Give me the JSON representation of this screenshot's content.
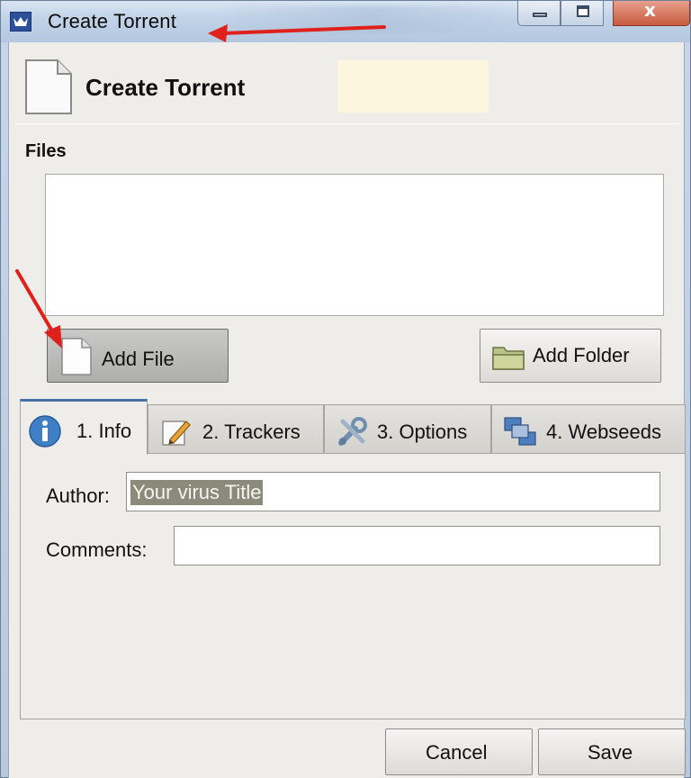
{
  "window": {
    "title": "Create Torrent",
    "controls": [
      "minimize",
      "maximize",
      "close"
    ],
    "close_glyph": "x"
  },
  "header": {
    "title": "Create Torrent",
    "icon": "document-icon"
  },
  "files": {
    "label": "Files",
    "add_file_label": "Add File",
    "add_folder_label": "Add Folder"
  },
  "tabs": [
    {
      "label": "1. Info",
      "icon": "info-icon",
      "selected": true
    },
    {
      "label": "2. Trackers",
      "icon": "pencil-icon",
      "selected": false
    },
    {
      "label": "3. Options",
      "icon": "tools-icon",
      "selected": false
    },
    {
      "label": "4. Webseeds",
      "icon": "network-icon",
      "selected": false
    }
  ],
  "info": {
    "author_label": "Author:",
    "author_value": "Your virus Title",
    "comments_label": "Comments:",
    "comments_value": ""
  },
  "footer": {
    "cancel_label": "Cancel",
    "save_label": "Save"
  },
  "colors": {
    "annotation_arrow": "#e0201a",
    "highlight": "#fdf6df",
    "selected_text_bg": "#8b8b7c"
  }
}
